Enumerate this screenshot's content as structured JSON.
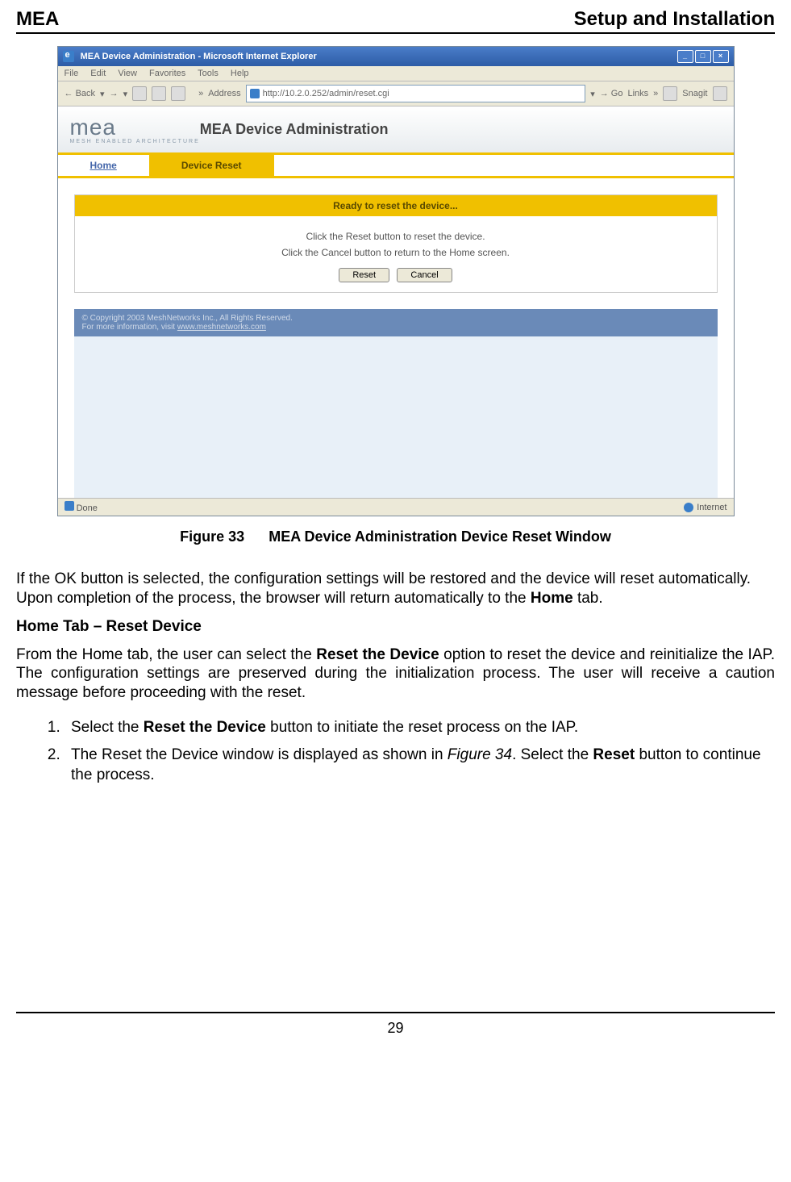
{
  "header": {
    "left": "MEA",
    "right": "Setup and Installation"
  },
  "browser": {
    "title": "MEA Device Administration - Microsoft Internet Explorer",
    "menu": {
      "file": "File",
      "edit": "Edit",
      "view": "View",
      "favorites": "Favorites",
      "tools": "Tools",
      "help": "Help"
    },
    "toolbar": {
      "back": "Back",
      "address_label": "Address",
      "url": "http://10.2.0.252/admin/reset.cgi",
      "go": "Go",
      "links": "Links",
      "snagit": "Snagit"
    },
    "page": {
      "logo": "mea",
      "logo_sub": "MESH ENABLED ARCHITECTURE",
      "title": "MEA Device Administration",
      "tab_home": "Home",
      "tab_reset": "Device Reset",
      "panel_header": "Ready to reset the device...",
      "instruction1": "Click the Reset button to reset the device.",
      "instruction2": "Click the Cancel button to return to the Home screen.",
      "btn_reset": "Reset",
      "btn_cancel": "Cancel",
      "copyright": "© Copyright 2003 MeshNetworks Inc., All Rights Reserved.",
      "copyright_link_label": "For more information, visit ",
      "copyright_link": "www.meshnetworks.com"
    },
    "status": {
      "left": "Done",
      "right": "Internet"
    }
  },
  "figure_caption": {
    "label": "Figure 33",
    "text": "MEA Device Administration Device Reset Window"
  },
  "paragraphs": {
    "p1_a": "If the OK button is selected, the configuration settings will be restored and the device will reset automatically.  Upon completion of the process, the browser will return automatically to the ",
    "p1_b": "Home",
    "p1_c": " tab.",
    "sub1": "Home Tab – Reset Device",
    "p2_a": "From the Home tab, the user can select the ",
    "p2_b": "Reset the Device",
    "p2_c": " option to reset the device and reinitialize the IAP.  The configuration settings are preserved during the initialization process.  The user will receive a caution message before proceeding with the reset.",
    "li1_a": "Select the ",
    "li1_b": "Reset the Device",
    "li1_c": " button to initiate the reset process on the IAP.",
    "li2_a": "The Reset the Device window is displayed as shown in ",
    "li2_b": "Figure 34",
    "li2_c": ".  Select the ",
    "li2_d": "Reset",
    "li2_e": " button to continue the process."
  },
  "page_number": "29"
}
